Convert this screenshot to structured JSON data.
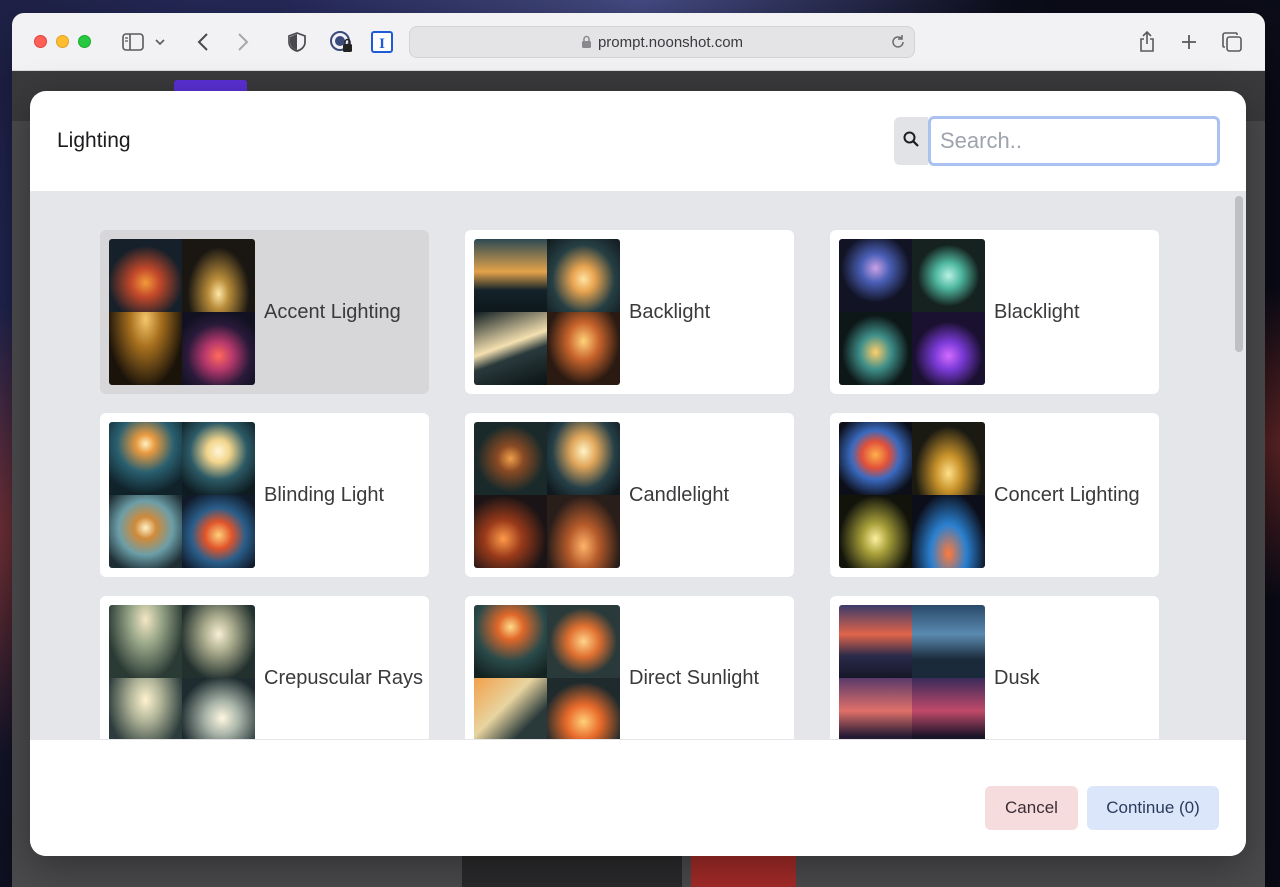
{
  "browser": {
    "url": "prompt.noonshot.com"
  },
  "modal": {
    "title": "Lighting",
    "search_placeholder": "Search..",
    "cancel_label": "Cancel",
    "continue_label": "Continue (0)"
  },
  "cards": [
    {
      "label": "Accent Lighting",
      "selected": true
    },
    {
      "label": "Backlight",
      "selected": false
    },
    {
      "label": "Blacklight",
      "selected": false
    },
    {
      "label": "Blinding Light",
      "selected": false
    },
    {
      "label": "Candlelight",
      "selected": false
    },
    {
      "label": "Concert Lighting",
      "selected": false
    },
    {
      "label": "Crepuscular Rays",
      "selected": false
    },
    {
      "label": "Direct Sunlight",
      "selected": false
    },
    {
      "label": "Dusk",
      "selected": false
    }
  ],
  "colors": {
    "selected_card": "#d7d7d9",
    "cancel_bg": "#f6dcdd",
    "continue_bg": "#dbe6fa",
    "search_focus": "#a9c2ef"
  }
}
